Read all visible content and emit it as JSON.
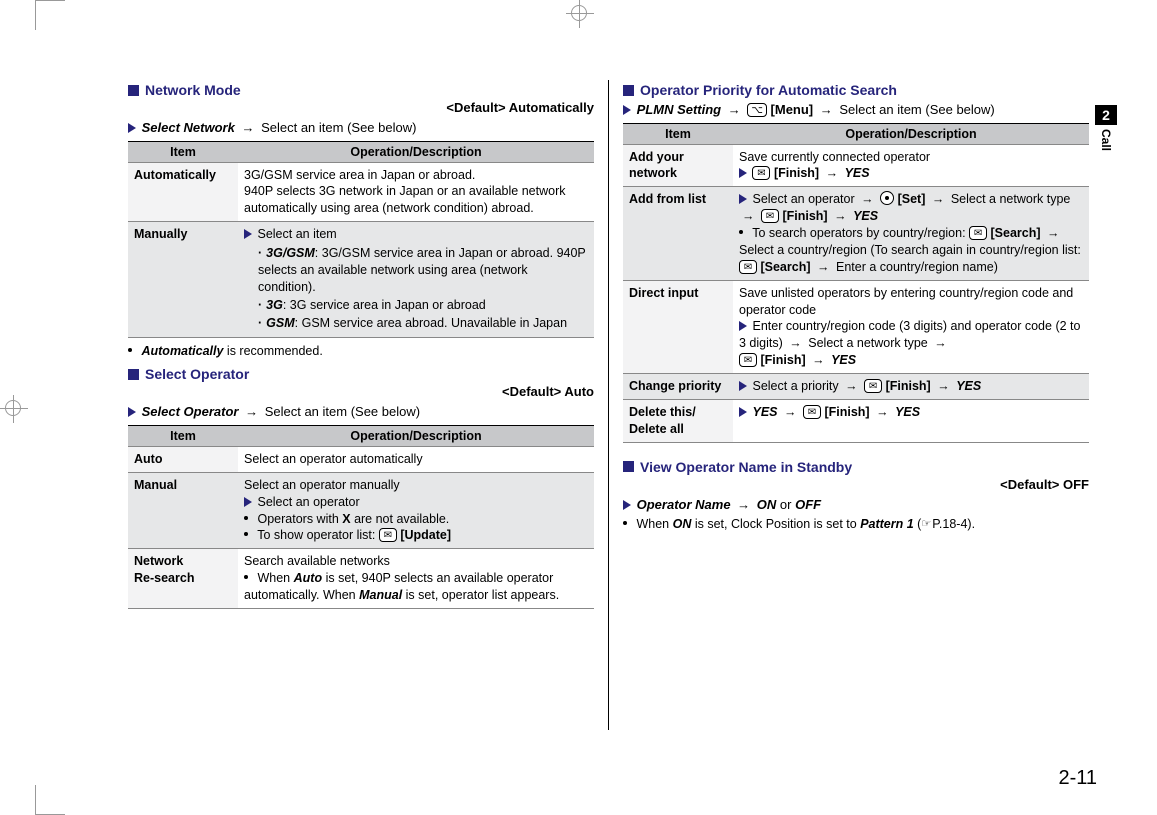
{
  "page_number": "2-11",
  "side_tab": {
    "number": "2",
    "label": "Call"
  },
  "left": {
    "sec1": {
      "title": "Network Mode",
      "default": "<Default> Automatically",
      "path_label": "Select Network",
      "path_tail": "Select an item (See below)",
      "th_item": "Item",
      "th_desc": "Operation/Description",
      "r1_key": "Automatically",
      "r1_desc": "3G/GSM service area in Japan or abroad.\n940P selects 3G network in Japan or an available network automatically using area (network condition) abroad.",
      "r2_key": "Manually",
      "r2_lead": "Select an item",
      "r2_a_label": "3G/GSM",
      "r2_a_desc": ": 3G/GSM service area in Japan or abroad. 940P selects an available network using area (network condition).",
      "r2_b_label": "3G",
      "r2_b_desc": ": 3G service area in Japan or abroad",
      "r2_c_label": "GSM",
      "r2_c_desc": ": GSM service area abroad. Unavailable in Japan",
      "note_auto_1": "Automatically",
      "note_auto_2": " is recommended."
    },
    "sec2": {
      "title": "Select Operator",
      "default": "<Default> Auto",
      "path_label": "Select Operator",
      "path_tail": "Select an item (See below)",
      "th_item": "Item",
      "th_desc": "Operation/Description",
      "r1_key": "Auto",
      "r1_desc": "Select an operator automatically",
      "r2_key": "Manual",
      "r2_line1": "Select an operator manually",
      "r2_line2": "Select an operator",
      "r2_line3a": "Operators with ",
      "r2_line3b": "X",
      "r2_line3c": " are not available.",
      "r2_line4a": "To show operator list: ",
      "r2_line4b": "[Update]",
      "r3_key": "Network\nRe-search",
      "r3_line1": "Search available networks",
      "r3_line2a": "When ",
      "r3_line2b": "Auto",
      "r3_line2c": " is set, 940P selects an available operator automatically. When ",
      "r3_line2d": "Manual",
      "r3_line2e": " is set, operator list appears."
    }
  },
  "right": {
    "sec3": {
      "title": "Operator Priority for Automatic Search",
      "path_label": "PLMN Setting",
      "path_mid": "[Menu]",
      "path_tail": "Select an item (See below)",
      "th_item": "Item",
      "th_desc": "Operation/Description",
      "r1_key": "Add your network",
      "r1_line1": "Save currently connected operator",
      "r1_btn": "[Finish]",
      "r1_yes": "YES",
      "r2_key": "Add from list",
      "r2_a1": "Select an operator",
      "r2_a2": "[Set]",
      "r2_a3": "Select a network type",
      "r2_a4": "[Finish]",
      "r2_a5": "YES",
      "r2_b1": "To search operators by country/region: ",
      "r2_b2": "[Search]",
      "r2_b3": "Select a country/region (To search again in country/region list: ",
      "r2_b4": "[Search]",
      "r2_b5": "Enter a country/region name)",
      "r3_key": "Direct input",
      "r3_line1": "Save unlisted operators by entering country/region code and operator code",
      "r3_line2a": "Enter country/region code (3 digits) and operator code (2 to 3 digits)",
      "r3_line2b": "Select a network type",
      "r3_btn": "[Finish]",
      "r3_yes": "YES",
      "r4_key": "Change priority",
      "r4_a": "Select a priority",
      "r4_btn": "[Finish]",
      "r4_yes": "YES",
      "r5_key": "Delete this/\nDelete all",
      "r5_yes1": "YES",
      "r5_btn": "[Finish]",
      "r5_yes2": "YES"
    },
    "sec4": {
      "title": "View Operator Name in Standby",
      "default": "<Default> OFF",
      "path_label": "Operator Name",
      "path_on": "ON",
      "path_or": " or ",
      "path_off": "OFF",
      "note_a": "When ",
      "note_b": "ON",
      "note_c": " is set, Clock Position is set to ",
      "note_d": "Pattern 1",
      "note_e": " (",
      "note_ref": "P.18-4",
      "note_f": ")."
    }
  },
  "icons": {
    "mail": "✉",
    "menu": "⌥"
  }
}
